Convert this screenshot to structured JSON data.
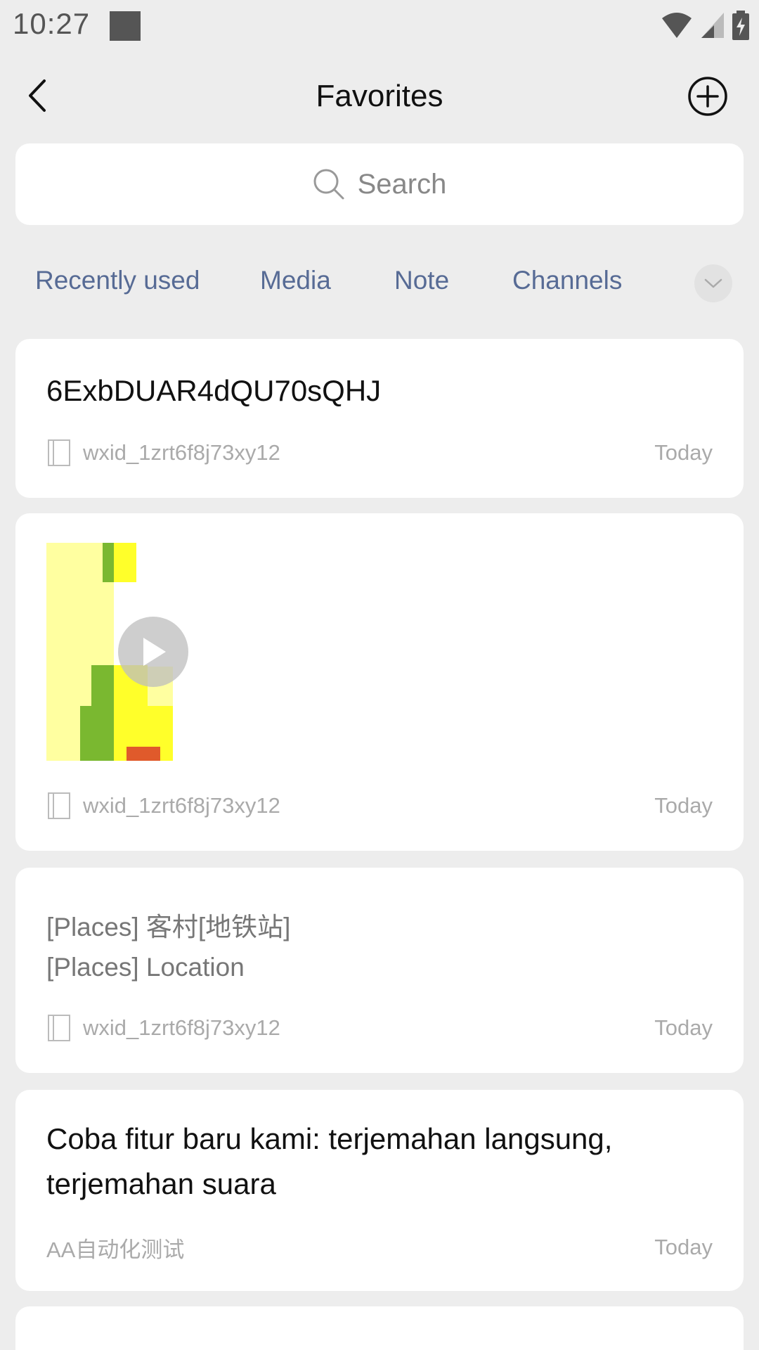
{
  "status_bar": {
    "time": "10:27",
    "icons": [
      "notification-square-icon",
      "wifi-icon",
      "cell-signal-icon",
      "battery-charging-icon"
    ]
  },
  "header": {
    "title": "Favorites",
    "back_icon": "back-chevron-icon",
    "add_icon": "add-circle-icon"
  },
  "search": {
    "placeholder": "Search",
    "icon": "search-icon"
  },
  "tabs": {
    "items": [
      "Recently used",
      "Media",
      "Note",
      "Channels"
    ],
    "more_icon": "chevron-down-icon"
  },
  "items": [
    {
      "type": "text",
      "title": "6ExbDUAR4dQU70sQHJ",
      "source": "wxid_1zrt6f8j73xy12",
      "date": "Today"
    },
    {
      "type": "video",
      "source": "wxid_1zrt6f8j73xy12",
      "date": "Today"
    },
    {
      "type": "location",
      "line1": "[Places] 客村[地铁站]",
      "line2": "[Places] Location",
      "source": "wxid_1zrt6f8j73xy12",
      "date": "Today"
    },
    {
      "type": "text",
      "title_line1": "Coba fitur baru kami: terjemahan langsung,",
      "title_line2": "terjemahan suara",
      "source": "AA自动化测试",
      "date": "Today"
    }
  ],
  "colors": {
    "background": "#ededed",
    "card": "#ffffff",
    "tab_text": "#576b95",
    "meta_text": "#aaaaaa"
  }
}
